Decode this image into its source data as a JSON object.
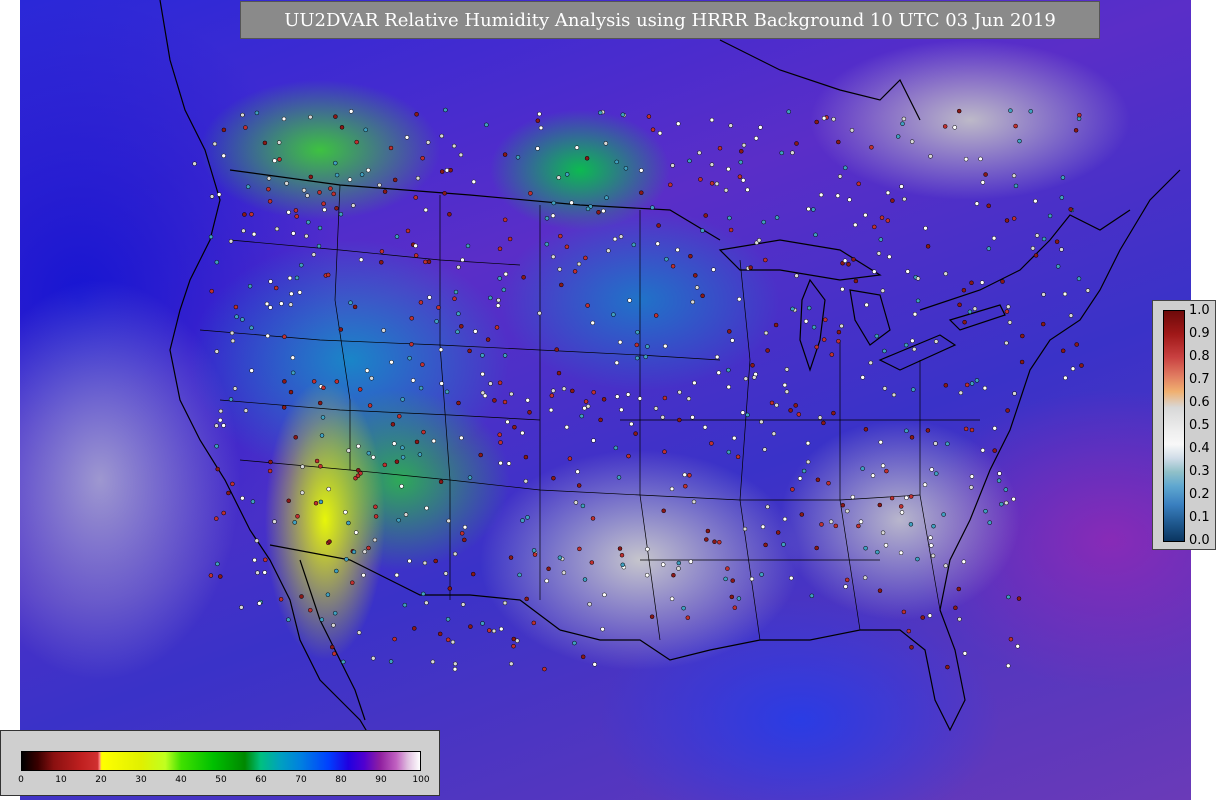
{
  "title": "UU2DVAR Relative Humidity Analysis using HRRR Background 10 UTC 03 Jun 2019",
  "observation_legend": {
    "ticks": [
      "1.0",
      "0.9",
      "0.8",
      "0.7",
      "0.6",
      "0.5",
      "0.4",
      "0.3",
      "0.2",
      "0.1",
      "0.0"
    ]
  },
  "field_colorbar": {
    "ticks": [
      "0",
      "10",
      "20",
      "30",
      "40",
      "50",
      "60",
      "70",
      "80",
      "90",
      "100"
    ]
  },
  "colors": {
    "dry": "#f0ff00",
    "moist_mid": "#00c000",
    "humid": "#2a28d8",
    "saturated": "#c8c8c8",
    "coastline": "#000000"
  }
}
